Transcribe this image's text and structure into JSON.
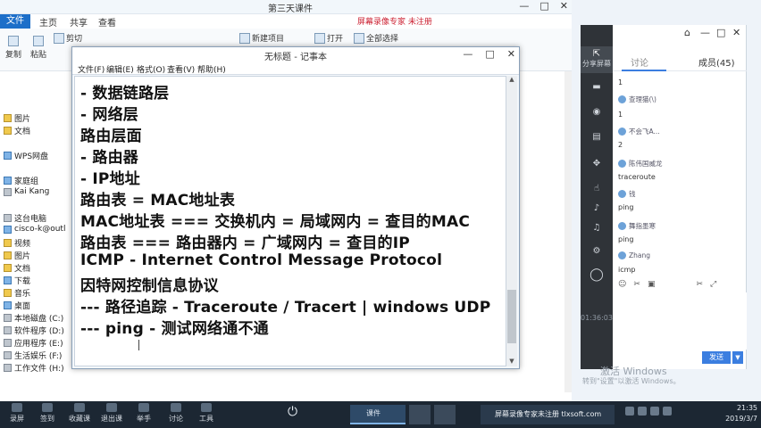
{
  "explorer": {
    "title": "第三天课件",
    "controls": [
      "—",
      "□",
      "✕"
    ],
    "ribbon_tabs": [
      "文件",
      "主页",
      "共享",
      "查看"
    ],
    "ribbon_buttons": [
      "复制",
      "粘贴",
      "剪切",
      "新建项目",
      "打开",
      "全部选择"
    ],
    "watermark_top": "屏幕录像专家 未注册",
    "nav_items": [
      "图片",
      "文档",
      "WPS网盘",
      "家庭组",
      "Kai Kang",
      "这台电脑",
      "cisco-k@outl",
      "视频",
      "图片",
      "文档",
      "下载",
      "音乐",
      "桌面",
      "本地磁盘 (C:)",
      "软件程序 (D:)",
      "应用程序 (E:)",
      "生活娱乐 (F:)",
      "工作文件 (H:)"
    ]
  },
  "notepad": {
    "title": "无标题 - 记事本",
    "controls": [
      "—",
      "□",
      "✕"
    ],
    "menu": [
      "文件(F)",
      "编辑(E)",
      "格式(O)",
      "查看(V)",
      "帮助(H)"
    ],
    "lines": [
      "- 数据链路层",
      "- 网络层",
      "路由层面",
      "- 路由器",
      "- IP地址",
      "路由表 = MAC地址表",
      "MAC地址表 === 交换机内 = 局域网内 = 查目的MAC",
      "路由表  === 路由器内 = 广域网内 = 查目的IP",
      "ICMP - Internet Control  Message Protocol",
      "因特网控制信息协议",
      "--- 路径追踪 - Traceroute / Tracert | windows UDP",
      "--- ping  - 测试网络通不通"
    ]
  },
  "chat": {
    "sidebar": {
      "share_screen": "分享屏幕",
      "time": "01:36:03"
    },
    "tab_discuss": "讨论",
    "tab_members": "成员(45)",
    "messages": [
      {
        "name": "",
        "text": "1"
      },
      {
        "name": "查理猫(\\)",
        "text": ""
      },
      {
        "name": "",
        "text": "1"
      },
      {
        "name": "不会飞A...",
        "text": ""
      },
      {
        "name": "",
        "text": "2"
      },
      {
        "name": "陈伟国威龙",
        "text": ""
      },
      {
        "name": "",
        "text": "traceroute"
      },
      {
        "name": "钱",
        "text": ""
      },
      {
        "name": "",
        "text": "ping"
      },
      {
        "name": "舞指墨寒",
        "text": ""
      },
      {
        "name": "",
        "text": "ping"
      },
      {
        "name": "Zhang",
        "text": ""
      },
      {
        "name": "",
        "text": "icmp"
      }
    ],
    "send": "发送",
    "activate_title": "激活 Windows",
    "activate_sub": "转到\"设置\"以激活 Windows。"
  },
  "taskbar": {
    "items": [
      "录屏",
      "签到",
      "收藏课",
      "退出课",
      "举手",
      "讨论",
      "工具"
    ],
    "task1": "课件",
    "task4": "屏幕录像专家未注册 tlxsoft.com",
    "clock_time": "21:35",
    "clock_date": "2019/3/7"
  }
}
